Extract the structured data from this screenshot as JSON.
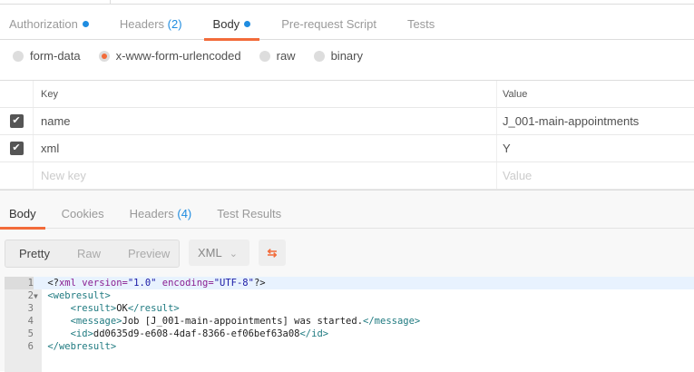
{
  "request_tabs": [
    {
      "label": "Authorization",
      "dot": true
    },
    {
      "label": "Headers",
      "count": "(2)"
    },
    {
      "label": "Body",
      "dot": true,
      "active": true
    },
    {
      "label": "Pre-request Script"
    },
    {
      "label": "Tests"
    }
  ],
  "body_modes": [
    "form-data",
    "x-www-form-urlencoded",
    "raw",
    "binary"
  ],
  "params": {
    "headers": {
      "key": "Key",
      "value": "Value"
    },
    "rows": [
      {
        "key": "name",
        "value": "J_001-main-appointments"
      },
      {
        "key": "xml",
        "value": "Y"
      }
    ],
    "placeholder_key": "New key",
    "placeholder_value": "Value"
  },
  "response_tabs": [
    {
      "label": "Body"
    },
    {
      "label": "Cookies"
    },
    {
      "label": "Headers",
      "count": "(4)"
    },
    {
      "label": "Test Results"
    }
  ],
  "view": {
    "pretty": "Pretty",
    "raw": "Raw",
    "preview": "Preview",
    "format": "XML"
  },
  "code": {
    "l1_open": "<?",
    "l1_xml": "xml",
    "l1_ver": " version=",
    "l1_vv": "\"1.0\"",
    "l1_enc": " encoding=",
    "l1_ev": "\"UTF-8\"",
    "l1_close": "?>",
    "l2": "<webresult>",
    "l3_o": "<result>",
    "l3_v": "OK",
    "l3_c": "</result>",
    "l4_o": "<message>",
    "l4_v": "Job [J_001-main-appointments] was started.",
    "l4_c": "</message>",
    "l5_o": "<id>",
    "l5_v": "dd0635d9-e608-4daf-8366-ef06bef63a08",
    "l5_c": "</id>",
    "l6": "</webresult>",
    "line_numbers": [
      "1",
      "2",
      "3",
      "4",
      "5",
      "6"
    ]
  },
  "colors": {
    "accent": "#f26b3a",
    "blue": "#1f8ce0"
  }
}
